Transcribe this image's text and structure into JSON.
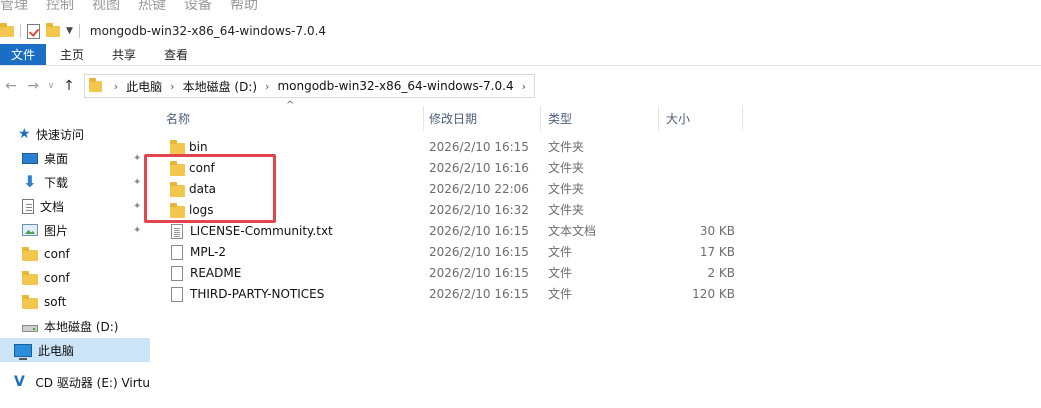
{
  "top_menu": [
    "管理",
    "控制",
    "视图",
    "热键",
    "设备",
    "帮助"
  ],
  "window": {
    "title": "mongodb-win32-x86_64-windows-7.0.4"
  },
  "ribbon": {
    "tabs": [
      "文件",
      "主页",
      "共享",
      "查看"
    ]
  },
  "address": {
    "crumbs": [
      "此电脑",
      "本地磁盘 (D:)",
      "mongodb-win32-x86_64-windows-7.0.4"
    ]
  },
  "navigation": {
    "quick_access": "快速访问",
    "items": [
      {
        "label": "桌面",
        "icon": "desktop-icon",
        "pinned": true
      },
      {
        "label": "下载",
        "icon": "download-icon",
        "pinned": true
      },
      {
        "label": "文档",
        "icon": "document-icon",
        "pinned": true
      },
      {
        "label": "图片",
        "icon": "picture-icon",
        "pinned": true
      },
      {
        "label": "conf",
        "icon": "folder-icon",
        "pinned": false
      },
      {
        "label": "conf",
        "icon": "folder-icon",
        "pinned": false
      },
      {
        "label": "soft",
        "icon": "folder-icon",
        "pinned": false
      },
      {
        "label": "本地磁盘 (D:)",
        "icon": "drive-icon",
        "pinned": false
      }
    ],
    "this_pc": "此电脑",
    "cd_drive": "CD 驱动器 (E:) Virtu"
  },
  "file_list": {
    "columns": {
      "name": "名称",
      "date": "修改日期",
      "type": "类型",
      "size": "大小"
    },
    "rows": [
      {
        "name": "bin",
        "date": "2026/2/10 16:15",
        "type": "文件夹",
        "size": "",
        "icon": "folder-icon"
      },
      {
        "name": "conf",
        "date": "2026/2/10 16:16",
        "type": "文件夹",
        "size": "",
        "icon": "folder-icon"
      },
      {
        "name": "data",
        "date": "2026/2/10 22:06",
        "type": "文件夹",
        "size": "",
        "icon": "folder-icon"
      },
      {
        "name": "logs",
        "date": "2026/2/10 16:32",
        "type": "文件夹",
        "size": "",
        "icon": "folder-icon"
      },
      {
        "name": "LICENSE-Community.txt",
        "date": "2026/2/10 16:15",
        "type": "文本文档",
        "size": "30 KB",
        "icon": "text-file-icon"
      },
      {
        "name": "MPL-2",
        "date": "2026/2/10 16:15",
        "type": "文件",
        "size": "17 KB",
        "icon": "file-icon"
      },
      {
        "name": "README",
        "date": "2026/2/10 16:15",
        "type": "文件",
        "size": "2 KB",
        "icon": "file-icon"
      },
      {
        "name": "THIRD-PARTY-NOTICES",
        "date": "2026/2/10 16:15",
        "type": "文件",
        "size": "120 KB",
        "icon": "file-icon"
      }
    ]
  },
  "colors": {
    "file_tab": "#1a6fc4",
    "highlight": "#e3454f",
    "selected_nav": "#cce4f7",
    "folder": "#f3c74e"
  }
}
